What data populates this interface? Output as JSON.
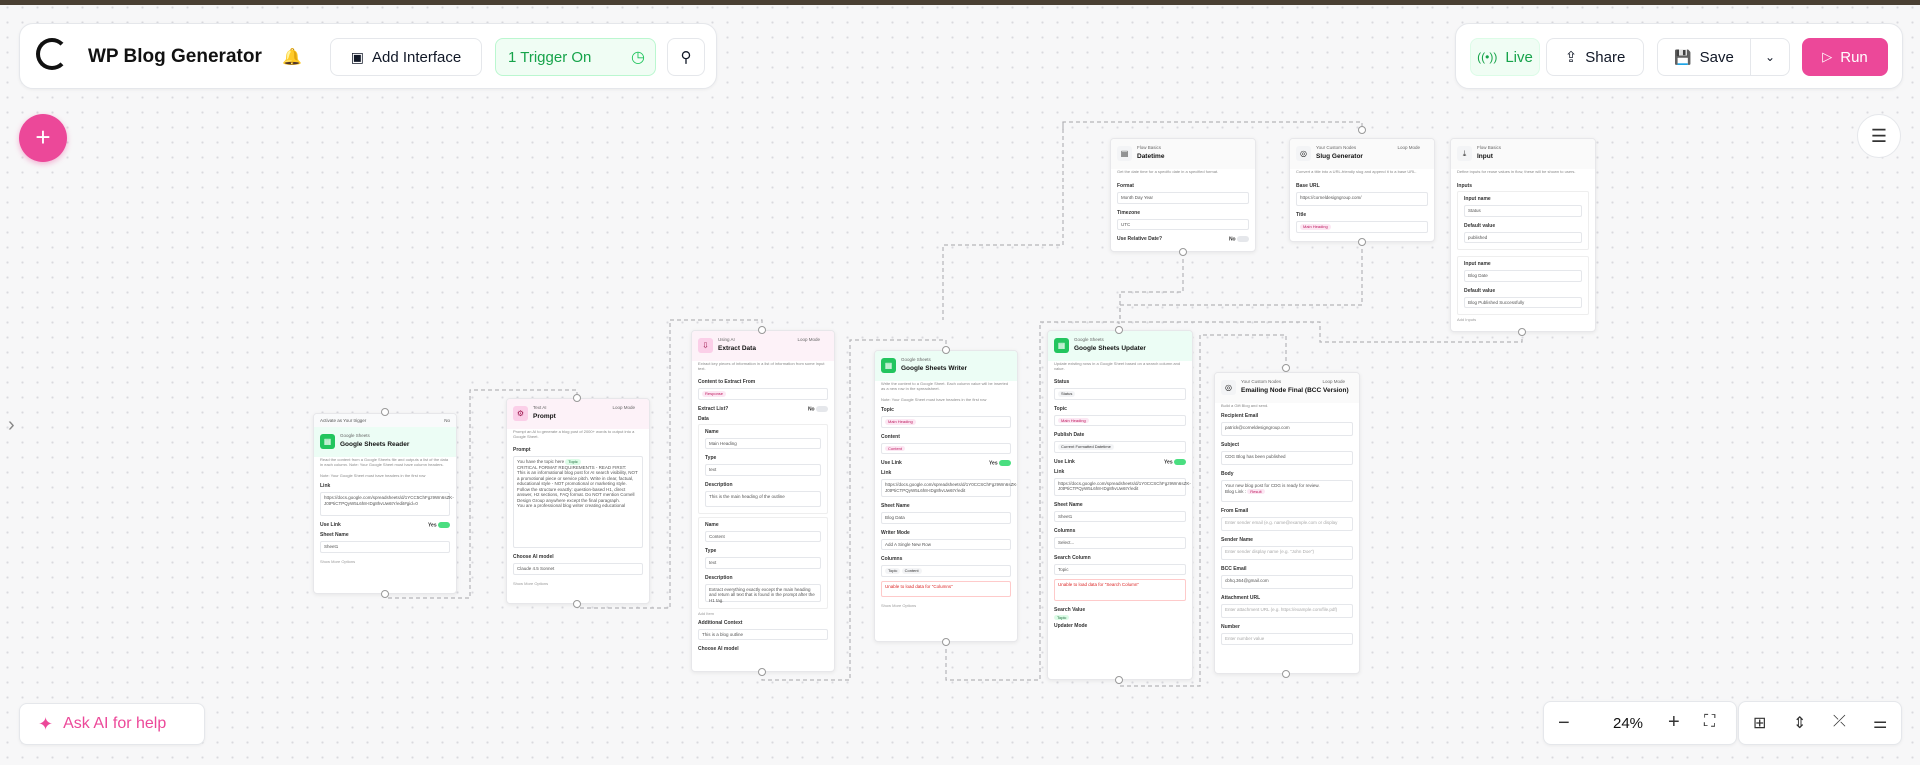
{
  "header": {
    "title": "WP Blog Generator",
    "add_interface": "Add Interface",
    "trigger": "1 Trigger On",
    "live": "Live",
    "share": "Share",
    "save": "Save",
    "run": "Run"
  },
  "ask_ai": "Ask AI for help",
  "zoom": "24%",
  "colors": {
    "accent": "#ec4899",
    "green": "#22c55e",
    "trigger_bg": "#f0fdf4"
  },
  "nodes": {
    "sheets_reader": {
      "trigger_label": "Activate as Your trigger",
      "toggle": "No",
      "tag": "Google Sheets",
      "title": "Google Sheets Reader",
      "desc": "Read the content from a Google Sheets file and outputs a list of the data in each column. Note: Your Google Sheet must have column headers.",
      "note": "Note: Your Google Sheet must have headers in the first row",
      "link_label": "Link",
      "link": "https://docs.google.com/spreadsheets/d/1YCC5ChFgz9Wn6sZK-J0tPtiCTPQyW5L6h8-IDg8hvUw6tY/edit#gid=0",
      "use_link": "Use Link",
      "use_link_val": "Yes",
      "sheet_label": "Sheet Name",
      "sheet": "Sheet1",
      "more": "Show More Options"
    },
    "prompt": {
      "tag": "Text AI",
      "title": "Prompt",
      "lm": "Loop Mode",
      "desc": "Prompt an AI to generate a blog post of 2000+ words to output into a Google Sheet.",
      "label": "Prompt",
      "topic_prefix": "You have the topic here",
      "topic_pill": "Topic",
      "lines": [
        "CRITICAL FORMAT REQUIREMENTS - READ FIRST:",
        "This is an informational blog post for AI search visibility, NOT a promotional piece or service pitch. Write in clear, factual, educational style - NOT promotional or marketing style. Follow the structure exactly: question-based H1, direct answer, H2 sections, FAQ format. Do NOT mention Cornell Design Group anywhere except the final paragraph.",
        "You are a professional blog writer creating educational"
      ],
      "model_label": "Choose AI model",
      "model": "Claude 4.5 Sonnet",
      "more": "Show More Options"
    },
    "extract": {
      "tag": "Using AI",
      "title": "Extract Data",
      "lm": "Loop Mode",
      "desc": "Extract key pieces of information in a list of information from some input text.",
      "ctx_label": "Content to Extract From",
      "ctx_pill": "Response",
      "list_label": "Extract List?",
      "list_val": "No",
      "data_label": "Data",
      "name_label": "Name",
      "name1": "Main Heading",
      "type_label": "Type",
      "type1": "text",
      "desc_label": "Description",
      "desc1": "This is the main heading of the outline",
      "name2": "Content",
      "type2": "text",
      "desc2": "Extract everything exactly except the main heading and return all text that is found in the prompt after the H1 tag.",
      "add_item": "Add Item",
      "addl_label": "Additional Context",
      "addl": "This is a blog outline",
      "model_label": "Choose AI model"
    },
    "writer": {
      "tag": "Google Sheets",
      "title": "Google Sheets Writer",
      "desc": "Write the content to a Google Sheet. Each column value will be inserted as a new row in the spreadsheet.",
      "note": "Note: Your Google Sheet must have headers in the first row",
      "topic_label": "Topic",
      "topic_pill": "Main Heading",
      "content_label": "Content",
      "content_pill": "Content",
      "use_link": "Use Link",
      "use_link_val": "Yes",
      "link_label": "Link",
      "link": "https://docs.google.com/spreadsheets/d/1Y0CCSChFgz9Wn6sZK-J0tPtiCTPQyW5L6h8-IDg8hvUw6tY/edit",
      "sheet_label": "Sheet Name",
      "sheet": "Blog Data",
      "mode_label": "Writer Mode",
      "mode": "Add A Single New Row",
      "cols_label": "Columns",
      "col1": "Topic",
      "col2": "Content",
      "warn": "Unable to load data for \"Columns\"",
      "more": "Show More Options"
    },
    "updater": {
      "tag": "Google Sheets",
      "title": "Google Sheets Updater",
      "desc": "Update existing rows in a Google Sheet based on a search column and value.",
      "status_label": "Status",
      "status_pill": "Status",
      "topic_label": "Topic",
      "topic_pill": "Main Heading",
      "publish_label": "Publish Date",
      "publish_pill": "Current Formatted Datetime",
      "use_link": "Use Link",
      "use_link_val": "Yes",
      "link_label": "Link",
      "link": "https://docs.google.com/spreadsheets/d/1Y0CCSChFgz9Wn6sZK-J0tPtiCTPQyW5L6h8-IDg8hvUw6tY/edit",
      "sheet_label": "Sheet Name",
      "sheet": "Sheet1",
      "cols_label": "Columns",
      "cols": "Select...",
      "search_label": "Search Column",
      "search": "Topic",
      "warn": "Unable to load data for \"Search Column\"",
      "sval_label": "Search Value",
      "sval_pill": "Topic",
      "mode_label": "Updater Mode"
    },
    "datetime": {
      "tag": "Flow Basics",
      "title": "Datetime",
      "desc": "Get the date time for a specific date in a specified format.",
      "format_label": "Format",
      "format": "Month Day Year",
      "tz_label": "Timezone",
      "tz": "UTC",
      "rel_label": "Use Relative Date?",
      "rel_val": "No"
    },
    "slug": {
      "tag": "Your Custom Nodes",
      "title": "Slug Generator",
      "lm": "Loop Mode",
      "desc": "Convert a title into a URL-friendly slug and append it to a base URL.",
      "base_label": "Base URL",
      "base": "https://corneldesigngroup.com/",
      "title_label": "Title",
      "title_pill": "Main Heading"
    },
    "input": {
      "tag": "Flow Basics",
      "title": "Input",
      "desc": "Define inputs for reuse values in flow, these will be shown to users.",
      "inputs_label": "Inputs",
      "in_name_label": "Input name",
      "in1": "Status",
      "def_label": "Default value",
      "def1": "published",
      "in2": "Blog Date",
      "def2": "Blog Published Successfully",
      "add": "Add Inputs"
    },
    "email": {
      "tag": "Your Custom Nodes",
      "title": "Emailing Node Final (BCC Version)",
      "lm": "Loop Mode",
      "desc": "Build a Gift Blog and send.",
      "to_label": "Recipient Email",
      "to": "patrick@corneldesigngroup.com",
      "subj_label": "Subject",
      "subj": "CDG Blog has been published",
      "body_label": "Body",
      "body": "Your new blog post for CDG is ready for review.",
      "body2_prefix": "Blog Link :",
      "body2_pill": "Result",
      "from_label": "From Email",
      "from_ph": "Enter sender email (e.g. name@example.com or display",
      "sender_label": "Sender Name",
      "sender_ph": "Enter sender display name (e.g. \"John Doe\")",
      "bcc_label": "BCC Email",
      "bcc": "cbhq.364@gmail.com",
      "att_label": "Attachment URL",
      "att_ph": "Enter attachment URL (e.g. https://example.com/file.pdf)",
      "num_label": "Number",
      "num_ph": "Enter number value"
    }
  }
}
